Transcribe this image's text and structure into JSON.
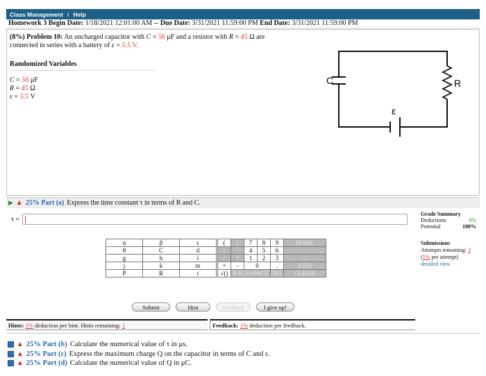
{
  "menu": {
    "items": [
      "Class Management",
      "Help"
    ],
    "separator": "I"
  },
  "assignment": {
    "title": "Homework 3",
    "begin_label": "Begin Date:",
    "begin": "1/18/2021 12:01:00 AM",
    "sep": "--",
    "due_label": "Due Date:",
    "due": "3/31/2021 11:59:00 PM",
    "end_label": "End Date:",
    "end": "3/31/2021 11:59:00 PM"
  },
  "problem": {
    "weight": "(8%)",
    "label": "Problem 10:",
    "text_1": "An uncharged capacitor with",
    "c_sym": "C",
    "eq": " = ",
    "c_val": "56",
    "c_unit": " μF and a resistor with ",
    "r_sym": "R",
    "r_val": "45",
    "r_unit": " Ω are",
    "text_2": "connected in series with a battery of",
    "e_sym": "ε",
    "e_val": "5.5",
    "e_unit": " V."
  },
  "randomized": {
    "title": "Randomized Variables",
    "vars": [
      {
        "sym": "C",
        "val": "56",
        "unit": " μF"
      },
      {
        "sym": "R",
        "val": "45",
        "unit": " Ω"
      },
      {
        "sym": "ε",
        "val": "5.5",
        "unit": " V"
      }
    ]
  },
  "circuit": {
    "c_label": "C",
    "r_label": "R",
    "e_label": "ε"
  },
  "part_a": {
    "label": "25% Part (a)",
    "text": "Express the time constant τ in terms of R and C."
  },
  "answer": {
    "label": "τ =",
    "value": ""
  },
  "grade": {
    "title": "Grade Summary",
    "deductions_label": "Deductions",
    "deductions": "0%",
    "potential_label": "Potential",
    "potential": "100%"
  },
  "submissions": {
    "title": "Submissions",
    "attempts_label": "Attempts remaining:",
    "attempts": "3",
    "per_attempt_pct": "1%",
    "per_attempt_text": " per attempt)",
    "detailed": "detailed view"
  },
  "keypad": {
    "greek": [
      [
        "α",
        "β",
        "ε"
      ],
      [
        "θ",
        "C",
        "d"
      ],
      [
        "g",
        "h",
        "i"
      ],
      [
        "j",
        "k",
        "m"
      ],
      [
        "P",
        "R",
        "t"
      ]
    ],
    "num": [
      [
        "(",
        ")",
        "7",
        "8",
        "9",
        "HOME"
      ],
      [
        "↑",
        "^",
        "4",
        "5",
        "6",
        "←"
      ],
      [
        "/",
        "*",
        "1",
        "2",
        "3",
        "→"
      ],
      [
        "+",
        "-",
        "0",
        ".",
        "END"
      ],
      [
        "√()",
        "BACKSPACE",
        "DEL",
        "CLEAR"
      ]
    ]
  },
  "buttons": {
    "submit": "Submit",
    "hint": "Hint",
    "feedback": "Feedback",
    "giveup": "I give up!"
  },
  "hints": {
    "label": "Hints:",
    "pct": "1%",
    "text": " deduction per hint. Hints remaining: ",
    "remaining": "1"
  },
  "feedback": {
    "label": "Feedback:",
    "pct": "1%",
    "text": " deduction per feedback."
  },
  "parts": [
    {
      "label": "25% Part (b)",
      "text": "Calculate the numerical value of τ in μs."
    },
    {
      "label": "25% Part (c)",
      "text": "Express the maximum charge Q on the capacitor in terms of C and ε."
    },
    {
      "label": "25% Part (d)",
      "text": "Calculate the numerical value of Q in μC."
    }
  ]
}
